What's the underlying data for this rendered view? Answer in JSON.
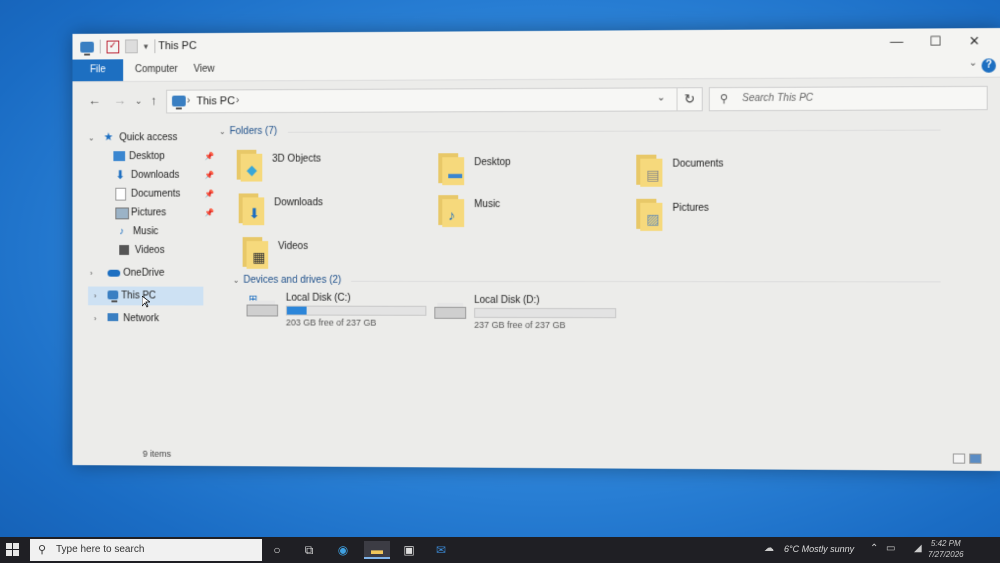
{
  "window": {
    "title": "This PC",
    "controls": {
      "minimize": "—",
      "maximize": "☐",
      "close": "✕"
    }
  },
  "ribbon": {
    "tabs": [
      {
        "label": "File"
      },
      {
        "label": "Computer"
      },
      {
        "label": "View"
      }
    ],
    "help": "?"
  },
  "nav": {
    "back": "←",
    "forward": "→",
    "up": "↑",
    "address_crumb": "This PC",
    "search_placeholder": "Search This PC"
  },
  "sidebar": {
    "quick_access": "Quick access",
    "quick_items": [
      {
        "label": "Desktop",
        "icon": "desktop-icon"
      },
      {
        "label": "Downloads",
        "icon": "downloads-icon"
      },
      {
        "label": "Documents",
        "icon": "documents-icon"
      },
      {
        "label": "Pictures",
        "icon": "pictures-icon"
      },
      {
        "label": "Music",
        "icon": "music-icon"
      },
      {
        "label": "Videos",
        "icon": "videos-icon"
      }
    ],
    "onedrive": "OneDrive",
    "this_pc": "This PC",
    "network": "Network"
  },
  "folders": {
    "header": "Folders (7)",
    "items": [
      {
        "label": "3D Objects"
      },
      {
        "label": "Desktop"
      },
      {
        "label": "Documents"
      },
      {
        "label": "Downloads"
      },
      {
        "label": "Music"
      },
      {
        "label": "Pictures"
      },
      {
        "label": "Videos"
      }
    ]
  },
  "drives": {
    "header": "Devices and drives (2)",
    "items": [
      {
        "name": "Local Disk (C:)",
        "free": "203 GB free of 237 GB",
        "used_fraction": 0.14
      },
      {
        "name": "Local Disk (D:)",
        "free": "237 GB free of 237 GB",
        "used_fraction": 0.0
      }
    ]
  },
  "status": {
    "count": "9 items"
  },
  "taskbar": {
    "search_placeholder": "Type here to search",
    "weather": "6°C  Mostly sunny",
    "time": "5:42 PM",
    "date": "7/27/2026"
  },
  "colors": {
    "accent": "#1d6fc1",
    "drive_fill": "#2c86d9",
    "folder": "#f6d97c"
  }
}
